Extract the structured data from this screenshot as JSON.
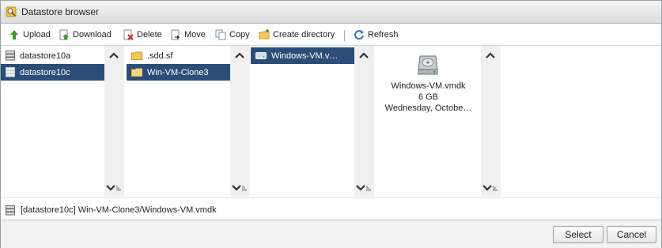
{
  "window": {
    "title": "Datastore browser"
  },
  "toolbar": {
    "upload": "Upload",
    "download": "Download",
    "delete": "Delete",
    "move": "Move",
    "copy": "Copy",
    "create_directory": "Create directory",
    "refresh": "Refresh"
  },
  "datastores": [
    {
      "label": "datastore10a",
      "selected": false
    },
    {
      "label": "datastore10c",
      "selected": true
    }
  ],
  "folders": [
    {
      "label": ".sdd.sf",
      "selected": false
    },
    {
      "label": "Win-VM-Clone3",
      "selected": true
    }
  ],
  "files": [
    {
      "label": "Windows-VM.v…",
      "selected": true
    }
  ],
  "details": {
    "icon": "hard-disk-icon",
    "name": "Windows-VM.vmdk",
    "size": "6 GB",
    "modified": "Wednesday, Octobe…"
  },
  "status": {
    "path": "[datastore10c] Win-VM-Clone3/Windows-VM.vmdk"
  },
  "buttons": {
    "select": "Select",
    "cancel": "Cancel"
  },
  "colors": {
    "selection": "#2a4e77",
    "accent_green": "#3a9a2a",
    "refresh_blue": "#2f6fc1",
    "folder": "#f2c85b"
  }
}
